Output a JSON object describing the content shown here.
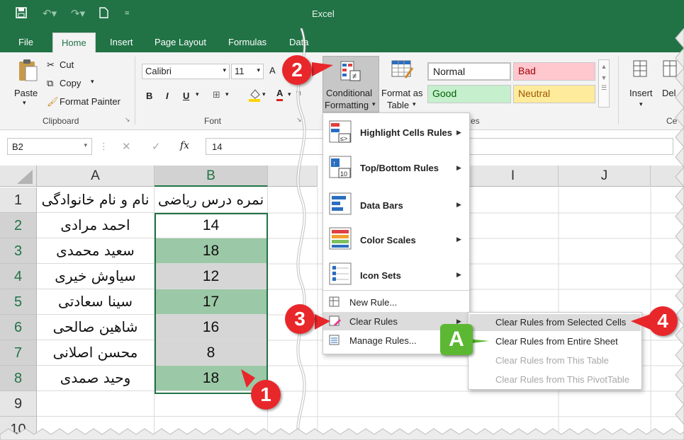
{
  "titlebar": {
    "title": "Excel"
  },
  "tabs": [
    "File",
    "Home",
    "Insert",
    "Page Layout",
    "Formulas",
    "Data"
  ],
  "ribbon": {
    "clipboard": {
      "paste": "Paste",
      "cut": "Cut",
      "copy": "Copy",
      "format_painter": "Format Painter",
      "label": "Clipboard"
    },
    "font": {
      "name": "Calibri",
      "size": "11",
      "label": "Font",
      "bold": "B",
      "italic": "I",
      "underline": "U"
    },
    "conditional_formatting": {
      "line1": "Conditional",
      "line2": "Formatting"
    },
    "format_as_table": {
      "line1": "Format as",
      "line2": "Table"
    },
    "styles": {
      "normal": "Normal",
      "bad": "Bad",
      "good": "Good",
      "neutral": "Neutral",
      "label_fragment": "es"
    },
    "cells": {
      "insert": "Insert",
      "delete_fragment": "Del",
      "label_fragment": "Ce"
    }
  },
  "formula_bar": {
    "namebox": "B2",
    "fx": "fx",
    "value": "14"
  },
  "columns": {
    "a": "A",
    "b": "B",
    "i": "I",
    "j": "J"
  },
  "rows": [
    {
      "n": "1",
      "name": "نام و نام خانوادگی",
      "score": "نمره درس ریاضی"
    },
    {
      "n": "2",
      "name": "احمد مرادی",
      "score": "14"
    },
    {
      "n": "3",
      "name": "سعید محمدی",
      "score": "18"
    },
    {
      "n": "4",
      "name": "سیاوش خیری",
      "score": "12"
    },
    {
      "n": "5",
      "name": "سینا سعادتی",
      "score": "17"
    },
    {
      "n": "6",
      "name": "شاهین صالحی",
      "score": "16"
    },
    {
      "n": "7",
      "name": "محسن اصلانی",
      "score": "8"
    },
    {
      "n": "8",
      "name": "وحید صمدی",
      "score": "18"
    },
    {
      "n": "9",
      "name": "",
      "score": ""
    },
    {
      "n": "10",
      "name": "",
      "score": ""
    }
  ],
  "menu": {
    "highlight": "Highlight Cells Rules",
    "topbottom": "Top/Bottom Rules",
    "databars": "Data Bars",
    "colorscales": "Color Scales",
    "iconsets": "Icon Sets",
    "newrule": "New Rule...",
    "clearrules": "Clear Rules",
    "managerules": "Manage Rules..."
  },
  "submenu": {
    "selected": "Clear Rules from Selected Cells",
    "entire": "Clear Rules from Entire Sheet",
    "table": "Clear Rules from This Table",
    "pivot": "Clear Rules from This PivotTable"
  },
  "callouts": {
    "one": "1",
    "two": "2",
    "three": "3",
    "four": "4",
    "a": "A"
  },
  "colors": {
    "excel_green": "#217346",
    "callout_red": "#e8272b",
    "callout_green": "#5cb832",
    "cell_green": "#9bc8a6"
  }
}
